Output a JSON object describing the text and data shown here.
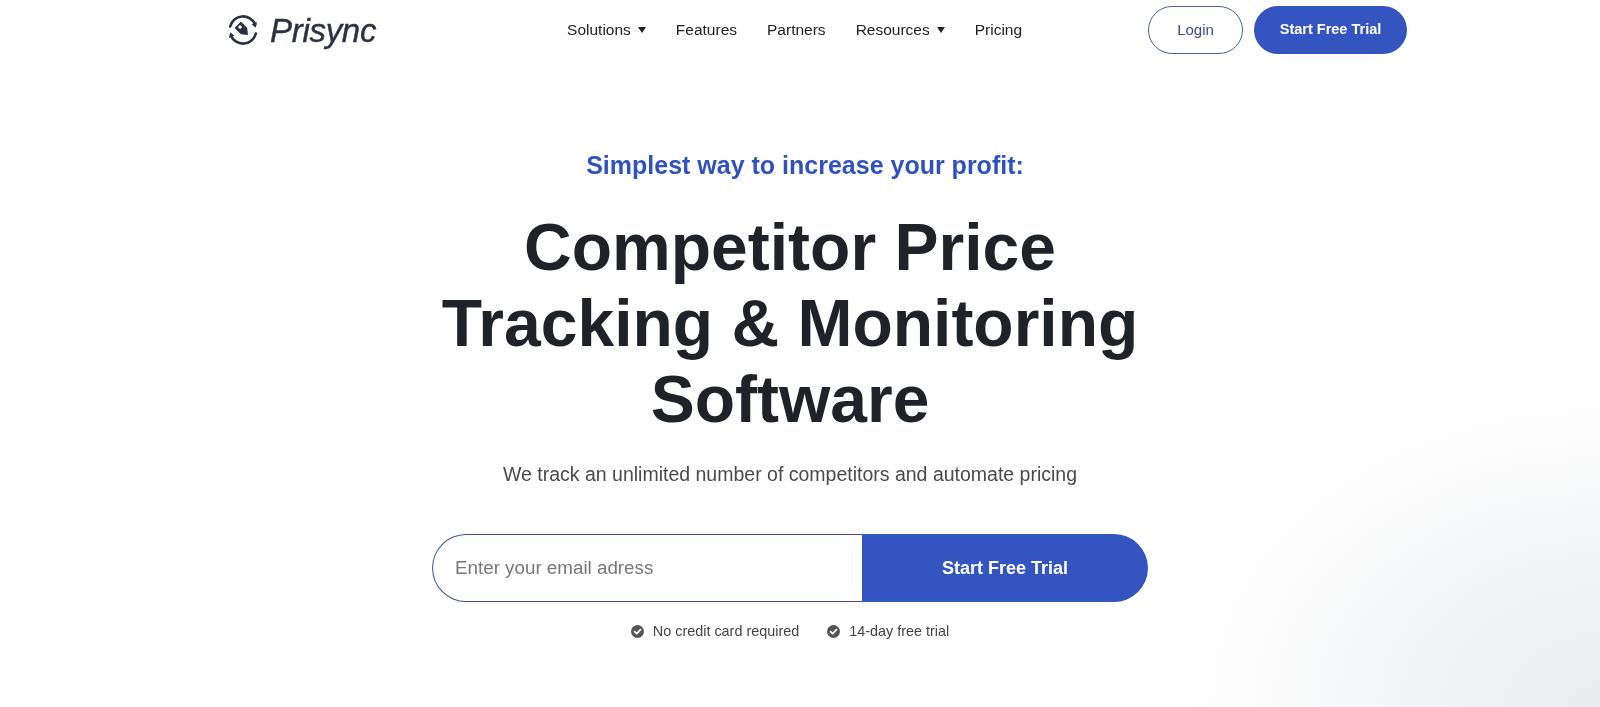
{
  "header": {
    "logo": {
      "text": "Prisync"
    },
    "nav": [
      {
        "label": "Solutions",
        "has_menu": true
      },
      {
        "label": "Features",
        "has_menu": false
      },
      {
        "label": "Partners",
        "has_menu": false
      },
      {
        "label": "Resources",
        "has_menu": true
      },
      {
        "label": "Pricing",
        "has_menu": false
      }
    ],
    "login_button": "Login",
    "trial_button": "Start Free Trial"
  },
  "hero": {
    "eyebrow": "Simplest way to increase your profit:",
    "headline": [
      "Competitor Price",
      "Tracking & Monitoring",
      "Software"
    ],
    "subtitle": "We track an unlimited number of competitors and automate pricing",
    "signup": {
      "placeholder": "Enter your email adress",
      "button": "Start Free Trial"
    },
    "perks": [
      "No credit card required",
      "14-day free trial"
    ]
  }
}
